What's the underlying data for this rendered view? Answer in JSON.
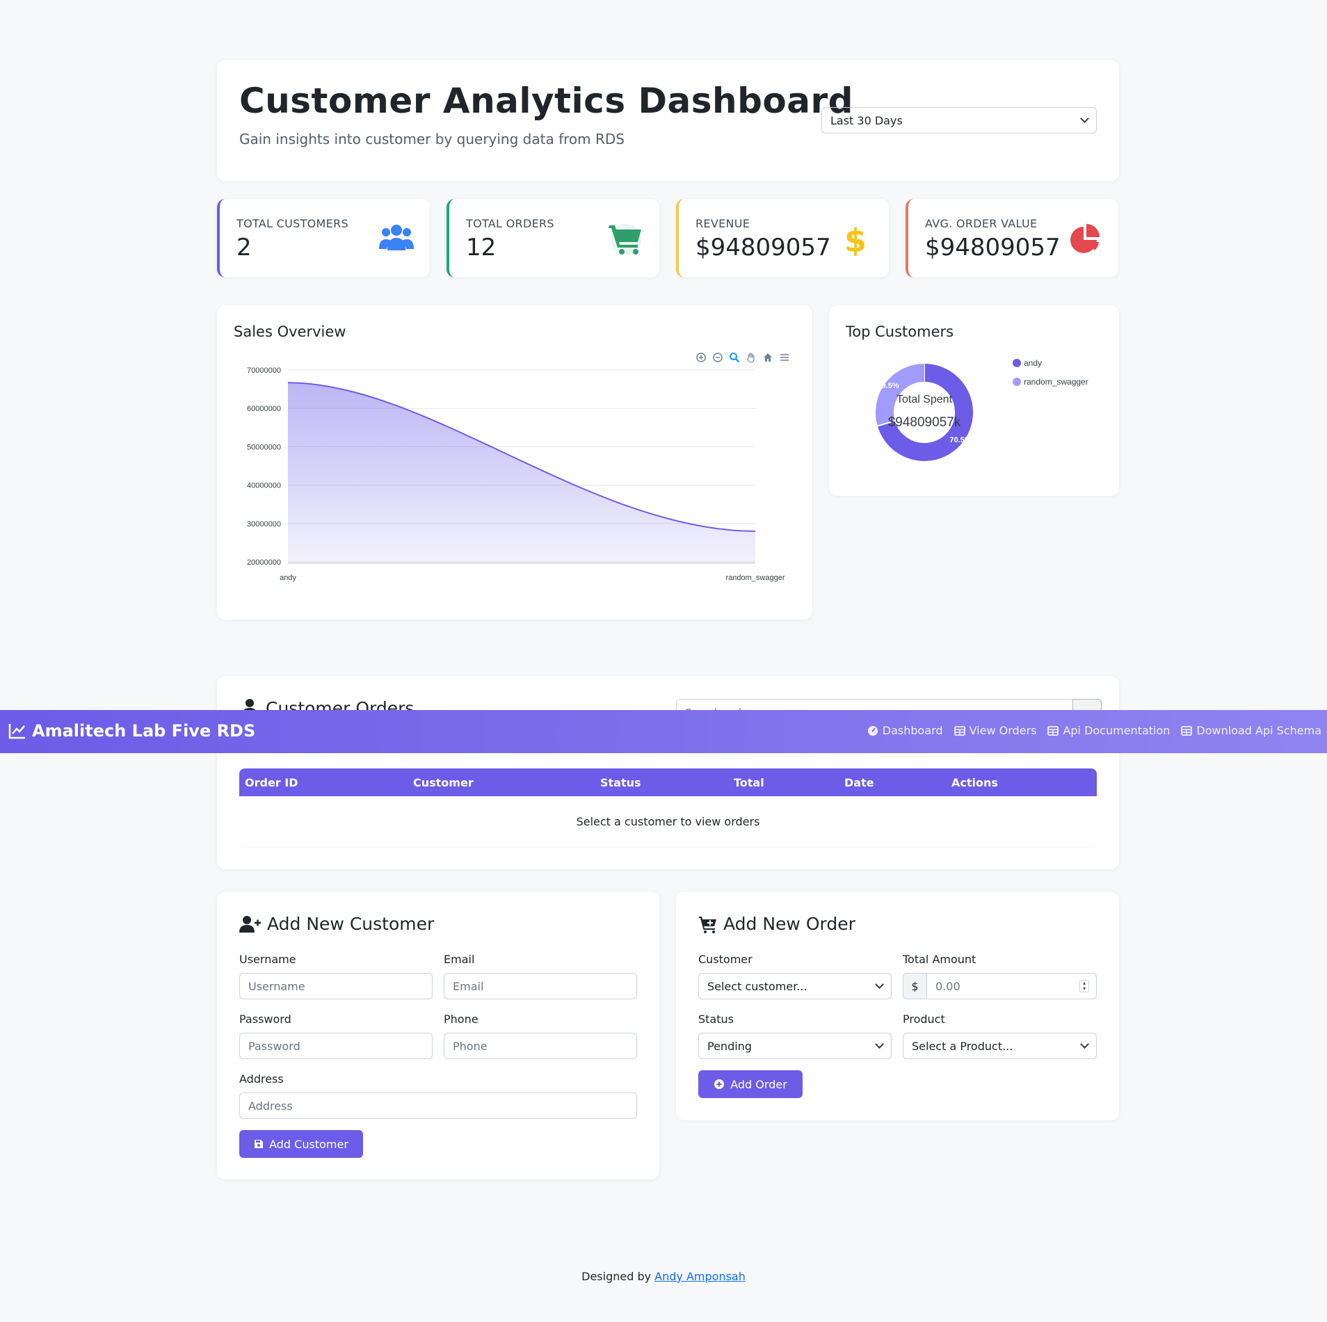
{
  "header": {
    "title": "Customer Analytics Dashboard",
    "subtitle": "Gain insights into customer by querying data from RDS",
    "range_value": "Last 30 Days"
  },
  "stats": [
    {
      "label": "TOTAL CUSTOMERS",
      "value": "2",
      "accent": "#6c5ce7",
      "icon": "users-icon",
      "icon_color": "#3b82f6"
    },
    {
      "label": "TOTAL ORDERS",
      "value": "12",
      "accent": "#20a67a",
      "icon": "cart-icon",
      "icon_color": "#2f9e6a"
    },
    {
      "label": "REVENUE",
      "value": "$94809057",
      "accent": "#f5c84c",
      "icon": "dollar-icon",
      "icon_color": "#f5c518"
    },
    {
      "label": "AVG. ORDER VALUE",
      "value": "$94809057",
      "accent": "#e07a5f",
      "icon": "pie-chart-icon",
      "icon_color": "#e5484d"
    }
  ],
  "sales": {
    "title": "Sales Overview",
    "toolbar": [
      "zoom-in-icon",
      "zoom-out-icon",
      "selection-zoom-icon",
      "pan-icon",
      "home-icon",
      "menu-icon"
    ]
  },
  "top_customers": {
    "title": "Top Customers",
    "center_label": "Total Spent",
    "center_value": "$94809057k"
  },
  "chart_data": [
    {
      "type": "area",
      "title": "Sales Overview",
      "categories": [
        "andy",
        "random_swagger"
      ],
      "series": [
        {
          "values": [
            66700000,
            28000000
          ]
        }
      ],
      "ylim": [
        20000000,
        70000000
      ],
      "yticks": [
        "70000000",
        "60000000",
        "50000000",
        "40000000",
        "30000000",
        "20000000"
      ],
      "grid": true,
      "color": "#6c5ce7"
    },
    {
      "type": "pie",
      "title": "Top Customers",
      "labels": [
        "andy",
        "random_swagger"
      ],
      "values": [
        70.5,
        29.5
      ],
      "value_labels": [
        "70.5%",
        "29.5%"
      ],
      "colors": [
        "#6c5ce7",
        "#a29bfe"
      ],
      "legend": "top-right"
    }
  ],
  "orders": {
    "title": "Customer Orders",
    "filter_placeholder": "Search orders...",
    "columns": [
      "Order ID",
      "Customer",
      "Status",
      "Total",
      "Date",
      "Actions"
    ],
    "empty_text": "Select a customer to view orders"
  },
  "navbar": {
    "brand": "Amalitech Lab Five RDS",
    "items": [
      {
        "label": "Dashboard",
        "icon": "gauge-icon"
      },
      {
        "label": "View Orders",
        "icon": "table-icon"
      },
      {
        "label": "Api Documentation",
        "icon": "table-icon"
      },
      {
        "label": "Download Api Schema",
        "icon": "table-icon"
      }
    ]
  },
  "add_customer": {
    "title": "Add New Customer",
    "username_label": "Username",
    "username_placeholder": "Username",
    "email_label": "Email",
    "email_placeholder": "Email",
    "password_label": "Password",
    "password_placeholder": "Password",
    "phone_label": "Phone",
    "phone_placeholder": "Phone",
    "address_label": "Address",
    "address_placeholder": "Address",
    "submit": "Add Customer"
  },
  "add_order": {
    "title": "Add New Order",
    "customer_label": "Customer",
    "customer_value": "Select customer...",
    "amount_label": "Total Amount",
    "amount_prefix": "$",
    "amount_placeholder": "0.00",
    "status_label": "Status",
    "status_value": "Pending",
    "product_label": "Product",
    "product_value": "Select a Product...",
    "submit": "Add Order"
  },
  "footer": {
    "prefix": "Designed by",
    "author": "Andy Amponsah"
  }
}
